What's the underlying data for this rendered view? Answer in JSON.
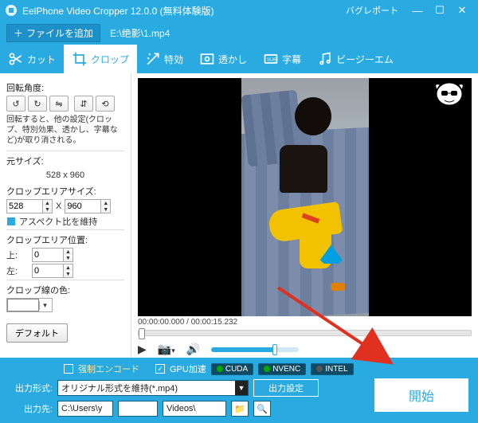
{
  "title": "EelPhone Video Cropper 12.0.0 (無料体験版)",
  "bug_report": "バグレポート",
  "filebar": {
    "add_file": "ファイルを追加",
    "current_file": "E:\\绝影\\1.mp4"
  },
  "tabs": {
    "cut": "カット",
    "crop": "クロップ",
    "effect": "特効",
    "watermark": "透かし",
    "subtitle": "字幕",
    "bgm": "ビージーエム"
  },
  "sidebar": {
    "rotate_label": "回転角度:",
    "rotate_note": "回転すると、他の設定(クロップ、特別効果、透かし、字幕など)が取り消される。",
    "orig_size_label": "元サイズ:",
    "orig_size_value": "528 x 960",
    "crop_size_label": "クロップエリアサイズ:",
    "crop_w": "528",
    "crop_x_sep": "X",
    "crop_h": "960",
    "aspect_label": "アスペクト比を維持",
    "crop_pos_label": "クロップエリア位置:",
    "top_label": "上:",
    "top_val": "0",
    "left_label": "左:",
    "left_val": "0",
    "line_color_label": "クロップ線の色:",
    "default_btn": "デフォルト"
  },
  "preview": {
    "time_start": "00:00:00.000",
    "time_end": "00:00:15.232"
  },
  "bottom": {
    "force_encode": "强制エンコード",
    "gpu_accel": "GPU加速",
    "chip_cuda": "CUDA",
    "chip_nvenc": "NVENC",
    "chip_intel": "INTEL",
    "format_label": "出力形式:",
    "format_value": "オリジナル形式を維持(*.mp4)",
    "out_settings": "出力設定",
    "dest_label": "出力先:",
    "path1": "C:\\Users\\y",
    "path2": "",
    "path3": "Videos\\",
    "start": "開始"
  }
}
